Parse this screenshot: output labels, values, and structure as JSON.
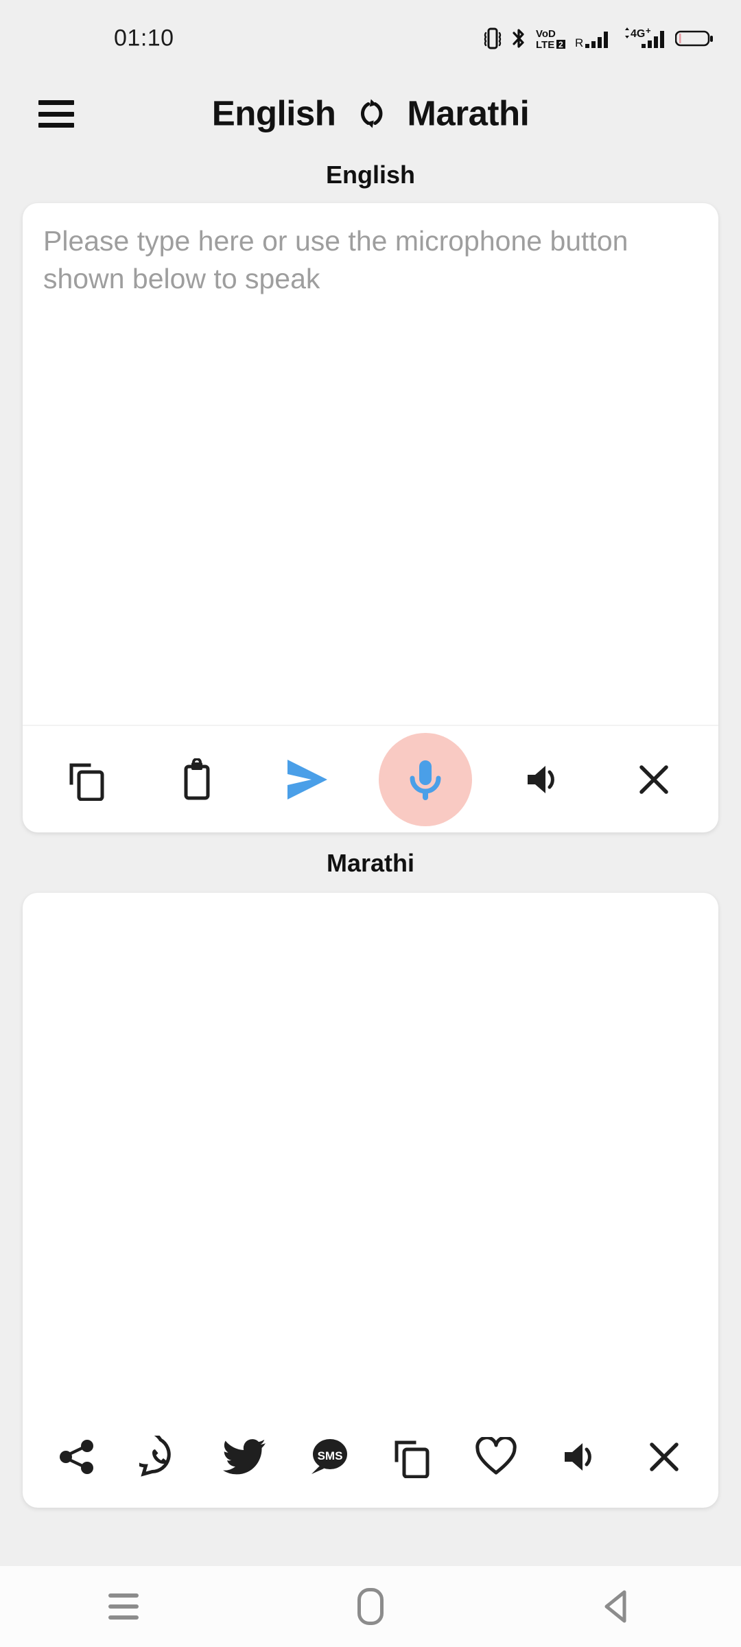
{
  "status_bar": {
    "time": "01:10",
    "icons": [
      {
        "name": "vibrate-icon",
        "label": "vibrate"
      },
      {
        "name": "bluetooth-icon",
        "label": "bluetooth"
      },
      {
        "name": "volte2-icon",
        "label": "VoLTE 2"
      },
      {
        "name": "roaming-signal-icon",
        "label": "R"
      },
      {
        "name": "4g-plus-signal-icon",
        "label": "4G+"
      },
      {
        "name": "battery-icon",
        "label": "battery"
      }
    ]
  },
  "header": {
    "menu_label": "menu",
    "source_language": "English",
    "swap_label": "swap languages",
    "target_language": "Marathi"
  },
  "source_panel": {
    "label": "English",
    "placeholder": "Please type here or use the microphone button shown below to speak",
    "value": "",
    "toolbar": [
      {
        "name": "copy-button",
        "label": "Copy",
        "icon": "copy-icon"
      },
      {
        "name": "paste-button",
        "label": "Paste",
        "icon": "clipboard-icon"
      },
      {
        "name": "send-button",
        "label": "Translate",
        "icon": "send-icon"
      },
      {
        "name": "mic-button",
        "label": "Speak",
        "icon": "microphone-icon"
      },
      {
        "name": "speak-button",
        "label": "Listen",
        "icon": "speaker-icon"
      },
      {
        "name": "clear-button",
        "label": "Clear",
        "icon": "close-icon"
      }
    ]
  },
  "target_panel": {
    "label": "Marathi",
    "placeholder": "",
    "value": "",
    "toolbar": [
      {
        "name": "share-button",
        "label": "Share",
        "icon": "share-icon"
      },
      {
        "name": "whatsapp-button",
        "label": "WhatsApp",
        "icon": "whatsapp-icon"
      },
      {
        "name": "twitter-button",
        "label": "Twitter",
        "icon": "twitter-icon"
      },
      {
        "name": "sms-button",
        "label": "SMS",
        "icon": "sms-icon"
      },
      {
        "name": "copy-button",
        "label": "Copy",
        "icon": "copy-icon"
      },
      {
        "name": "favorite-button",
        "label": "Favorite",
        "icon": "heart-icon"
      },
      {
        "name": "speak-button",
        "label": "Listen",
        "icon": "speaker-icon"
      },
      {
        "name": "clear-button",
        "label": "Clear",
        "icon": "close-icon"
      }
    ]
  },
  "nav_bar": {
    "recents_label": "Recents",
    "home_label": "Home",
    "back_label": "Back"
  },
  "colors": {
    "page_background": "#efefef",
    "card_background": "#ffffff",
    "accent_blue": "#4a9fe8",
    "mic_halo_pink": "#f9cac3",
    "icon_dark": "#1f1f1f",
    "placeholder_gray": "#9e9e9e",
    "nav_gray": "#8c8c8c"
  }
}
